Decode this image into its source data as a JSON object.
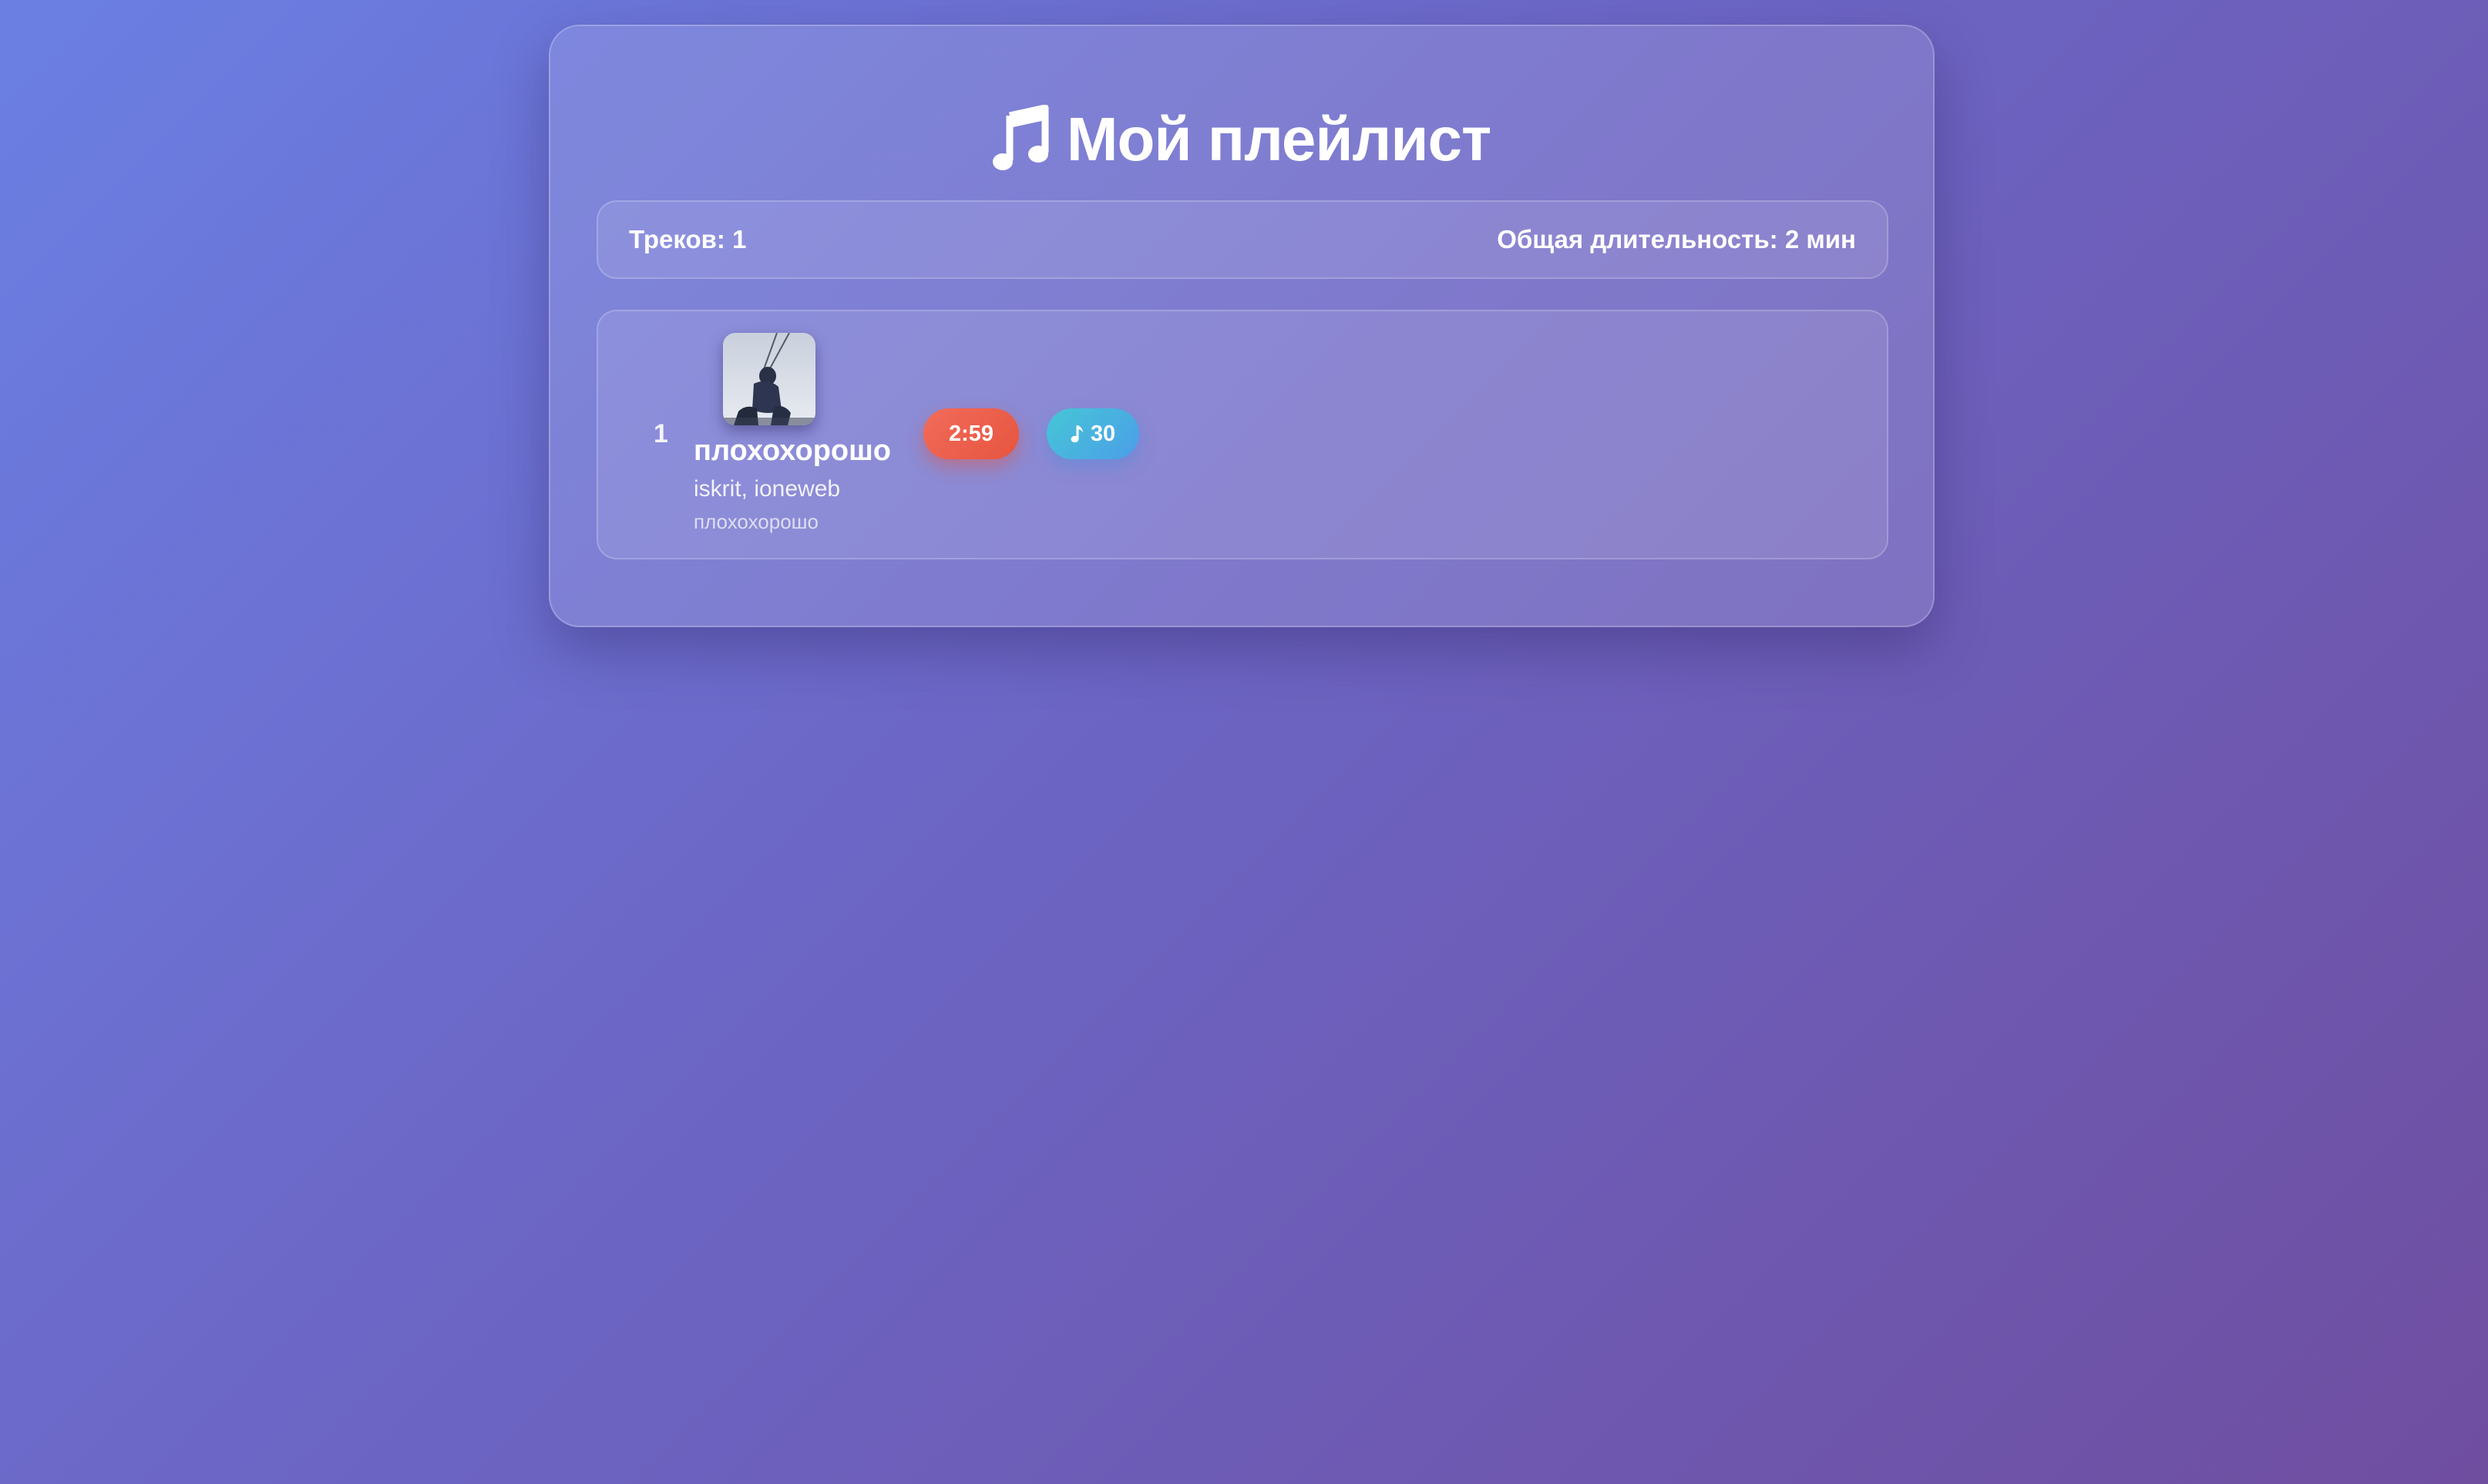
{
  "playlist": {
    "title": "Мой плейлист",
    "title_icon": "music-note-icon"
  },
  "stats": {
    "tracks_label": "Треков: 1",
    "duration_label": "Общая длительность: 2 мин"
  },
  "tracks": [
    {
      "number": "1",
      "cover_icon": "album-cover-image",
      "title": "плохохорошо",
      "artists": "iskrit, ioneweb",
      "album": "плохохорошо",
      "duration": "2:59",
      "popularity_icon": "music-note-icon",
      "popularity": "30"
    }
  ],
  "colors": {
    "duration_badge": "#e6553f",
    "popularity_badge": "#4b9ee8",
    "background_start": "#6b7fe3",
    "background_end": "#6f4ea0"
  }
}
